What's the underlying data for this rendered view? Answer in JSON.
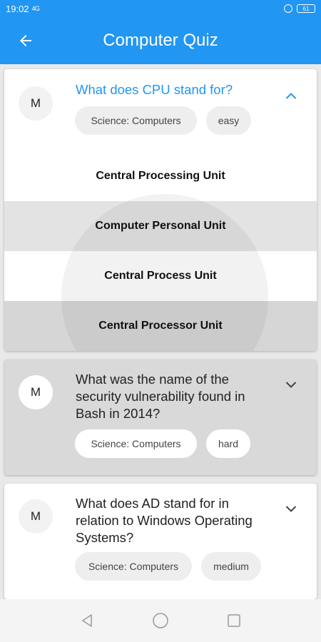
{
  "status": {
    "time": "19:02",
    "signal": "4G",
    "battery": "61"
  },
  "appbar": {
    "title": "Computer Quiz"
  },
  "questions": [
    {
      "avatar": "M",
      "text": "What does CPU stand for?",
      "category": "Science: Computers",
      "difficulty": "easy",
      "expanded": true,
      "answers": [
        "Central Processing Unit",
        "Computer Personal Unit",
        "Central Process Unit",
        "Central Processor Unit"
      ]
    },
    {
      "avatar": "M",
      "text": "What was the name of the security vulnerability found in Bash in 2014?",
      "category": "Science: Computers",
      "difficulty": "hard",
      "expanded": false
    },
    {
      "avatar": "M",
      "text": "What does AD stand for in relation to Windows Operating Systems?",
      "category": "Science: Computers",
      "difficulty": "medium",
      "expanded": false
    }
  ],
  "colors": {
    "primary": "#2196f3",
    "background": "#e9e9e9",
    "card": "#ffffff"
  },
  "icons": {
    "back": "arrow-left-icon",
    "collapse": "chevron-up-icon",
    "expand": "chevron-down-icon"
  }
}
